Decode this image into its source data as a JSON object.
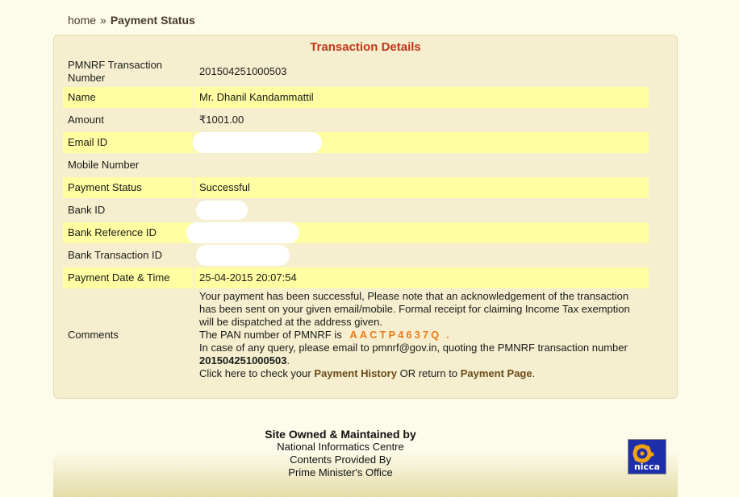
{
  "breadcrumb": {
    "home": "home",
    "separator": "»",
    "current": "Payment Status"
  },
  "panel": {
    "title": "Transaction Details"
  },
  "details": {
    "txn_label": "PMNRF Transaction Number",
    "txn_value": "201504251000503",
    "name_label": "Name",
    "name_value": "Mr. Dhanil Kandammattil",
    "amount_label": "Amount",
    "amount_value": "₹1001.00",
    "email_label": "Email ID",
    "mobile_label": "Mobile Number",
    "status_label": "Payment Status",
    "status_value": "Successful",
    "bank_id_label": "Bank ID",
    "bank_ref_label": "Bank Reference ID",
    "bank_txn_label": "Bank Transaction ID",
    "date_label": "Payment Date & Time",
    "date_value": "25-04-2015 20:07:54",
    "comments_label": "Comments"
  },
  "comments": {
    "line1": "Your payment has been successful, Please note that an acknowledgement of the transaction has been sent on your given email/mobile. Formal receipt for claiming Income Tax exemption will be dispatched at the address given.",
    "pan_prefix": "The PAN number of PMNRF is",
    "pan_value": "AACTP4637Q",
    "pan_suffix": ".",
    "query_text": "In case of any query, please email to pmnrf@gov.in, quoting the PMNRF transaction number",
    "query_txn": "201504251000503",
    "query_end": ".",
    "click_prefix": "Click here to check your",
    "history_link": "Payment History",
    "or_text": "OR return to",
    "payment_link": "Payment Page",
    "click_end": "."
  },
  "footer": {
    "owned": "Site Owned & Maintained by",
    "org": "National Informatics Centre",
    "provided": "Contents Provided By",
    "office": "Prime Minister's Office",
    "logo_text": "nicca"
  },
  "colors": {
    "background": "#fdfbea",
    "panel": "#f5efcf",
    "highlight_row": "#fffea2",
    "title": "#c0371a",
    "pan": "#f07a18",
    "logo": "#1d2ea8"
  },
  "icons": {
    "logo": "nic-logo-icon"
  }
}
